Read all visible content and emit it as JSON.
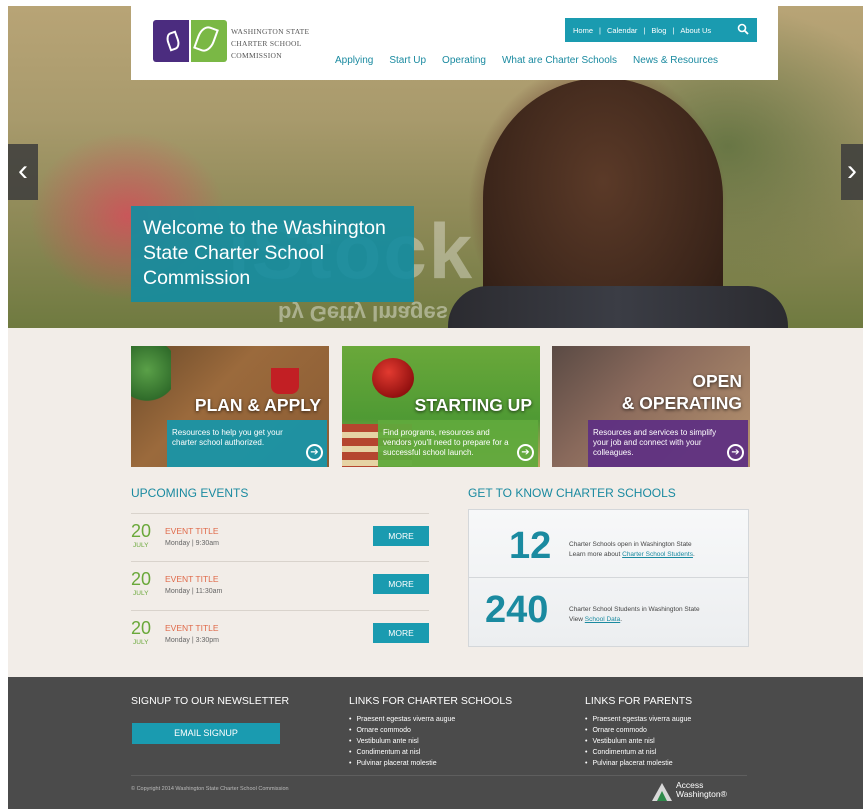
{
  "header": {
    "org_name_lines": [
      "WASHINGTON STATE",
      "CHARTER SCHOOL",
      "COMMISSION"
    ],
    "top_links": [
      "Home",
      "Calendar",
      "Blog",
      "About Us"
    ],
    "nav": [
      "Applying",
      "Start Up",
      "Operating",
      "What are Charter Schools",
      "News & Resources"
    ]
  },
  "hero": {
    "welcome": "Welcome to the Washington State Charter School Commission",
    "watermark": "iStock",
    "watermark_sub": "by Getty Images"
  },
  "tiles": [
    {
      "title": "PLAN & APPLY",
      "desc": "Resources to help you get your charter school authorized."
    },
    {
      "title": "STARTING UP",
      "desc": "Find programs, resources and vendors you'll need to prepare for a successful school launch."
    },
    {
      "title_line1": "OPEN",
      "title_line2": "& OPERATING",
      "desc": "Resources and services to simplify your job and connect with your colleagues."
    }
  ],
  "events": {
    "heading": "UPCOMING EVENTS",
    "items": [
      {
        "day": "20",
        "month": "JULY",
        "title": "EVENT TITLE",
        "time": "Monday | 9:30am",
        "button": "MORE"
      },
      {
        "day": "20",
        "month": "JULY",
        "title": "EVENT TITLE",
        "time": "Monday | 11:30am",
        "button": "MORE"
      },
      {
        "day": "20",
        "month": "JULY",
        "title": "EVENT TITLE",
        "time": "Monday | 3:30pm",
        "button": "MORE"
      }
    ]
  },
  "stats": {
    "heading": "GET TO KNOW CHARTER SCHOOLS",
    "items": [
      {
        "number": "12",
        "line1": "Charter Schools open in Washington State",
        "line2_prefix": "Learn more about ",
        "link": "Charter School Students",
        "suffix": "."
      },
      {
        "number": "240",
        "line1": "Charter School Students in Washington State",
        "line2_prefix": "View ",
        "link": "School Data",
        "suffix": "."
      }
    ]
  },
  "footer": {
    "newsletter_heading": "SIGNUP TO OUR NEWSLETTER",
    "signup_button": "EMAIL SIGNUP",
    "schools_heading": "LINKS FOR CHARTER SCHOOLS",
    "parents_heading": "LINKS FOR PARENTS",
    "schools_links": [
      "Praesent egestas viverra augue",
      "Ornare commodo",
      "Vestibulum ante nisl",
      "Condimentum at nisl",
      "Pulvinar placerat molestie"
    ],
    "parents_links": [
      "Praesent egestas viverra augue",
      "Ornare commodo",
      "Vestibulum ante nisl",
      "Condimentum at nisl",
      "Pulvinar placerat molestie"
    ],
    "copyright": "© Copyright 2014 Washington State Charter School Commission",
    "access_line1": "Access",
    "access_line2": "Washington®"
  },
  "colors": {
    "teal": "#1a9bb0",
    "purple": "#4b2c7f",
    "green": "#7ab845",
    "footer": "#4b4b4b"
  },
  "icons": [
    "search-icon",
    "chevron-left-icon",
    "chevron-right-icon",
    "arrow-circle-icon"
  ]
}
